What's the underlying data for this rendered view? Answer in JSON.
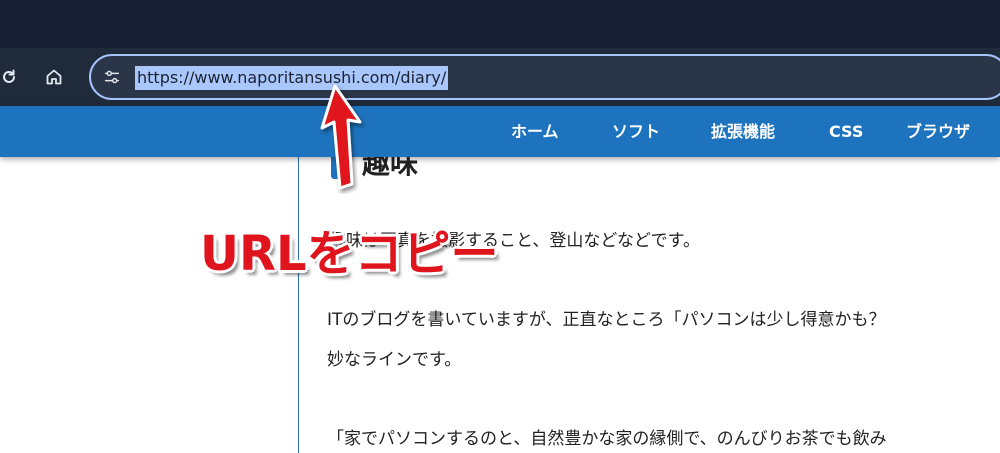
{
  "browser": {
    "url": "https://www.naporitansushi.com/diary/",
    "icons": {
      "reload": "reload-icon",
      "home": "home-icon",
      "site_info": "tune-icon"
    }
  },
  "site_nav": {
    "items": [
      {
        "label": "ホーム"
      },
      {
        "label": "ソフト"
      },
      {
        "label": "拡張機能"
      },
      {
        "label": "CSS"
      },
      {
        "label": "ブラウザ"
      }
    ]
  },
  "article": {
    "heading": "趣味",
    "paragraphs": [
      "趣味は写真を撮影すること、登山などなどです。",
      "ITのブログを書いていますが、正直なところ「パソコンは少し得意かも？",
      "妙なラインです。",
      "「家でパソコンするのと、自然豊かな家の縁側で、のんびりお茶でも飲み"
    ]
  },
  "annotation": {
    "text": "URLをコピー",
    "color": "#e0141c"
  },
  "colors": {
    "tab_strip": "#162032",
    "toolbar": "#1f2a3b",
    "nav_bar": "#1e73be",
    "url_highlight": "#a9c7fb"
  }
}
